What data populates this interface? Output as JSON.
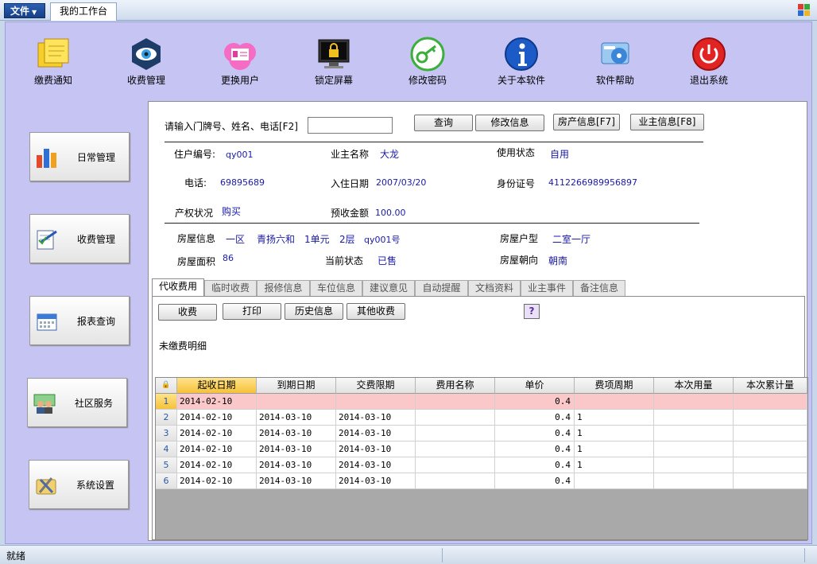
{
  "topbar": {
    "file_menu": "文件",
    "workbench_tab": "我的工作台"
  },
  "toolbar": [
    {
      "label": "缴费通知",
      "icon": "sticky-notes-icon"
    },
    {
      "label": "收费管理",
      "icon": "eye-icon"
    },
    {
      "label": "更换用户",
      "icon": "user-card-icon"
    },
    {
      "label": "锁定屏幕",
      "icon": "lock-screen-icon"
    },
    {
      "label": "修改密码",
      "icon": "key-icon"
    },
    {
      "label": "关于本软件",
      "icon": "info-icon"
    },
    {
      "label": "软件帮助",
      "icon": "help-disc-icon"
    },
    {
      "label": "退出系统",
      "icon": "power-icon"
    }
  ],
  "nav": [
    {
      "label": "日常管理",
      "icon": "bar-chart-icon"
    },
    {
      "label": "收费管理",
      "icon": "edit-document-icon"
    },
    {
      "label": "报表查询",
      "icon": "calendar-icon"
    },
    {
      "label": "社区服务",
      "icon": "people-icon"
    },
    {
      "label": "系统设置",
      "icon": "tools-icon"
    }
  ],
  "search": {
    "prompt": "请输入门牌号、姓名、电话[F2]",
    "value": "",
    "query_button": "查询",
    "edit_button": "修改信息",
    "property_button": "房产信息[F7]",
    "owner_button": "业主信息[F8]"
  },
  "resident": {
    "id_label": "住户编号:",
    "id_value": "qy001",
    "owner_label": "业主名称",
    "owner_value": "大龙",
    "use_label": "使用状态",
    "use_value": "自用",
    "phone_label": "电话:",
    "phone_value": "69895689",
    "movein_label": "入住日期",
    "movein_value": "2007/03/20",
    "idcard_label": "身份证号",
    "idcard_value": "4112266989956897",
    "rights_label": "产权状况",
    "rights_value": "购买",
    "prepaid_label": "预收金额",
    "prepaid_value": "100.00"
  },
  "property": {
    "info_label": "房屋信息",
    "district": "一区",
    "complex": "青扬六和",
    "unit": "1单元",
    "floor": "2层",
    "room": "qy001号",
    "type_label": "房屋户型",
    "type_value": "二室一厅",
    "area_label": "房屋面积",
    "area_value": "86",
    "status_label": "当前状态",
    "status_value": "已售",
    "facing_label": "房屋朝向",
    "facing_value": "朝南"
  },
  "tabs": [
    "代收费用",
    "临时收费",
    "报修信息",
    "车位信息",
    "建议意见",
    "自动提醒",
    "文档资料",
    "业主事件",
    "备注信息"
  ],
  "actions": {
    "charge": "收费",
    "print": "打印",
    "history": "历史信息",
    "other": "其他收费",
    "help": "?"
  },
  "grid": {
    "title": "未缴费明细",
    "columns": [
      "起收日期",
      "到期日期",
      "交费限期",
      "费用名称",
      "单价",
      "费项周期",
      "本次用量",
      "本次累计量"
    ],
    "rows": [
      [
        "1",
        "2014-02-10",
        "",
        "",
        "",
        "0.4",
        "",
        "",
        ""
      ],
      [
        "2",
        "2014-02-10",
        "2014-03-10",
        "2014-03-10",
        "",
        "0.4",
        "1",
        "",
        ""
      ],
      [
        "3",
        "2014-02-10",
        "2014-03-10",
        "2014-03-10",
        "",
        "0.4",
        "1",
        "",
        ""
      ],
      [
        "4",
        "2014-02-10",
        "2014-03-10",
        "2014-03-10",
        "",
        "0.4",
        "1",
        "",
        ""
      ],
      [
        "5",
        "2014-02-10",
        "2014-03-10",
        "2014-03-10",
        "",
        "0.4",
        "1",
        "",
        ""
      ],
      [
        "6",
        "2014-02-10",
        "2014-03-10",
        "2014-03-10",
        "",
        "0.4",
        "",
        "",
        ""
      ]
    ]
  },
  "status": {
    "text": "就绪"
  }
}
